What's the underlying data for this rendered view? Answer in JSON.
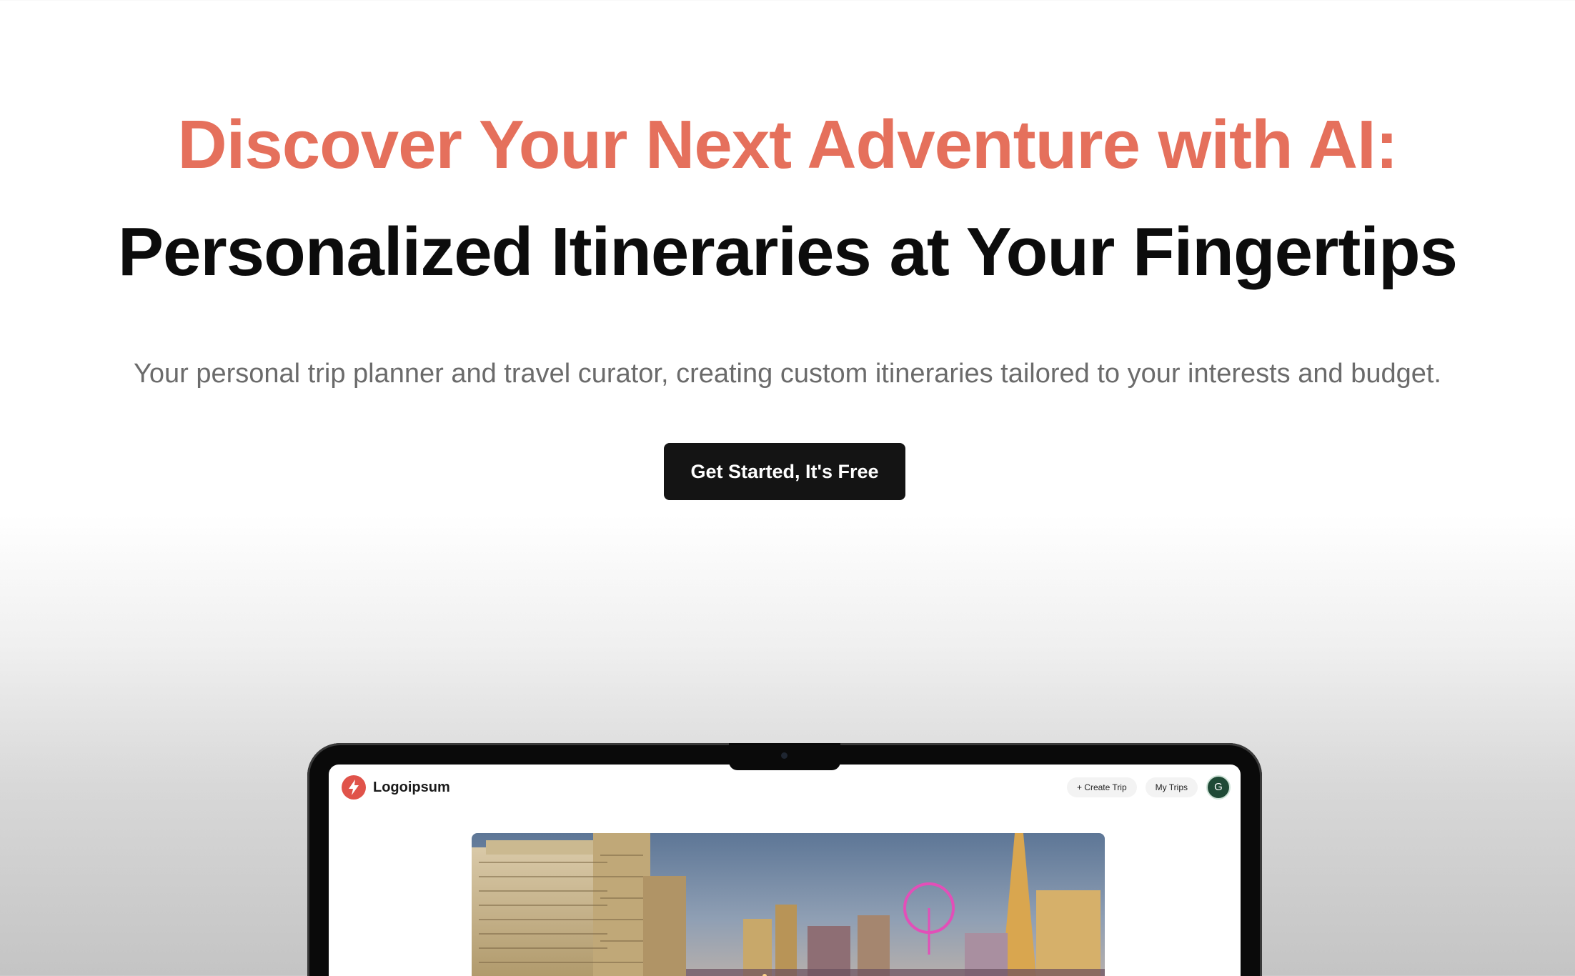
{
  "hero": {
    "headline_accent": "Discover Your Next Adventure with AI:",
    "headline_main": "Personalized Itineraries at Your Fingertips",
    "subtitle": "Your personal trip planner and travel curator, creating custom itineraries tailored to your interests and budget.",
    "cta_label": "Get Started, It's Free"
  },
  "mockup": {
    "logo_text": "Logoipsum",
    "logo_icon": "lightning-bolt-icon",
    "nav": {
      "create_trip_label": "+ Create Trip",
      "my_trips_label": "My Trips",
      "avatar_initial": "G"
    },
    "hero_image_subject": "city skyline at dusk"
  },
  "colors": {
    "accent": "#e5705c",
    "heading": "#0c0c0c",
    "subtitle": "#6b6b6b",
    "cta_background": "#141414",
    "avatar_background": "#1f4a36"
  }
}
